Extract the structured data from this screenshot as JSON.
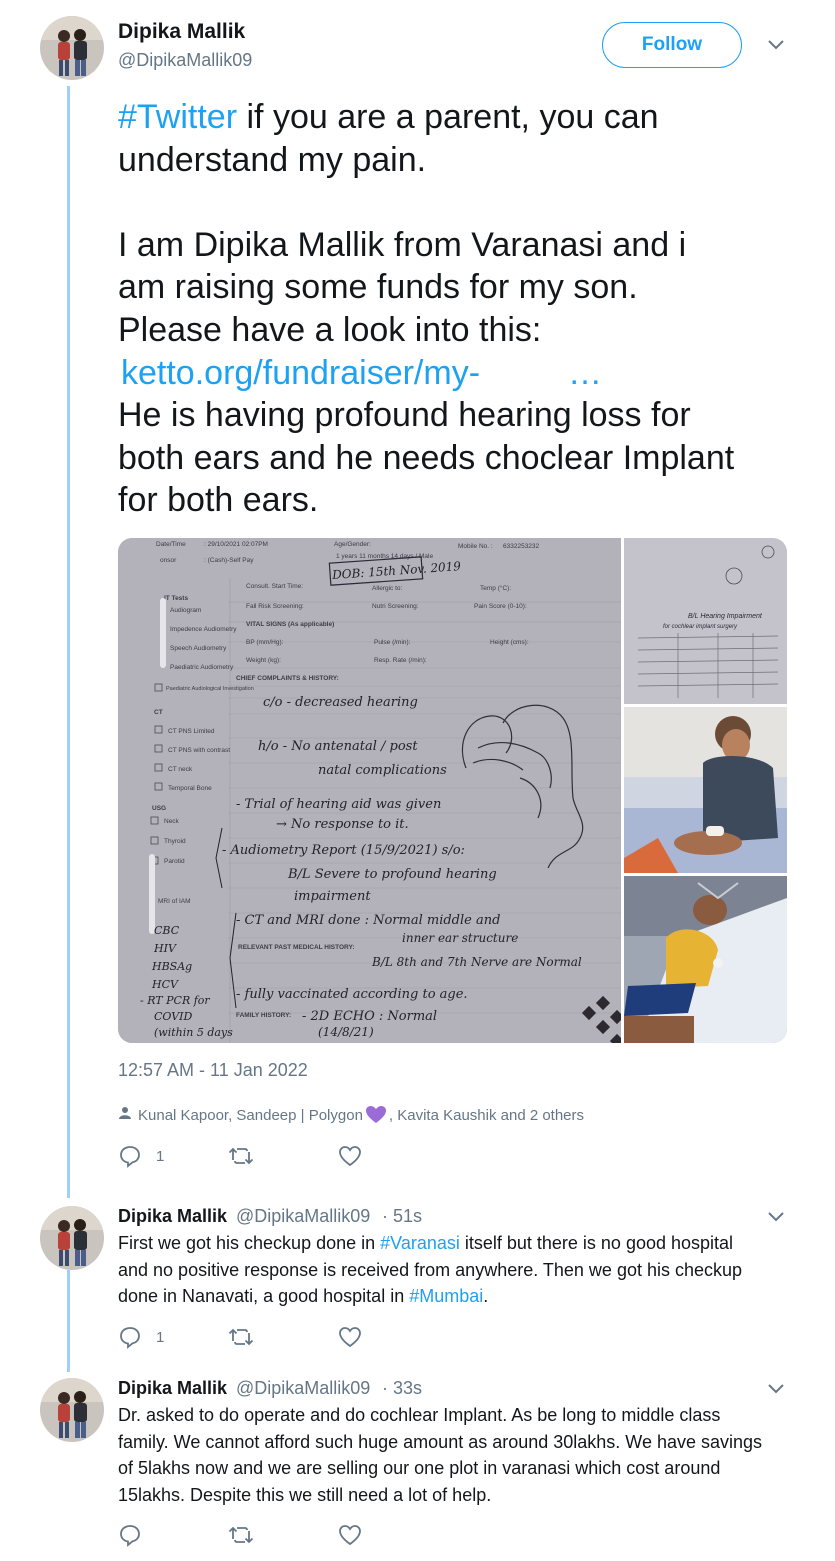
{
  "main_tweet": {
    "author_name": "Dipika Mallik",
    "author_handle": "@DipikaMallik09",
    "follow_label": "Follow",
    "text_lines": [
      {
        "hashtag": "#Twitter",
        "rest": " if you are a parent, you can"
      },
      {
        "text": "understand my pain."
      },
      {
        "text": ""
      },
      {
        "text": "I am Dipika Mallik from Varanasi and i"
      },
      {
        "text": "am raising some funds for my son."
      },
      {
        "text": "Please have a look into this:"
      },
      {
        "link": "ketto.org/fundraiser/my-",
        "ellipsis": "…"
      },
      {
        "text": "He is having profound hearing loss for"
      },
      {
        "text": "both ears and he needs choclear Implant"
      },
      {
        "text": "for both ears."
      }
    ],
    "timestamp": "12:57 AM - 11 Jan 2022",
    "liked_by": "Kunal Kapoor, Sandeep | Polygon",
    "liked_by_rest": ", Kavita Kaushik and 2 others",
    "reply_count": "1",
    "retweet_count": "",
    "like_count": "",
    "media": {
      "document_texts": {
        "date_label": "Date/Time",
        "date_value": ": 29/10/2021 02:07PM",
        "sponsor_label": "onsor",
        "sponsor_value": ": (Cash)-Self Pay",
        "age_label": "Age/Gender:",
        "age_value": "1 years 11 months 14 days / Male",
        "mobile_label": "Mobile No. :",
        "mobile_value": "6332253232",
        "dob": "DOB: 15th Nov. 2019",
        "consult": "Consult. Start Time:",
        "allergic": "Allergic to:",
        "temp": "Temp (°C):",
        "fall": "Fall Risk Screening:",
        "nutri": "Nutri Screening:",
        "pain": "Pain Score (0-10):",
        "tests": "IT Tests",
        "audiogram": "Audiogram",
        "impedance": "Impedence Audiometry",
        "speech": "Speech Audiometry",
        "paediatric": "Paediatric Audiometry",
        "paed_invest": "Paediatric Audiological Investigation",
        "vital": "VITAL SIGNS (As applicable)",
        "bp": "BP (mm/Hg):",
        "pulse": "Pulse (/min):",
        "height": "Height (cms):",
        "weight": "Weight (kg):",
        "resp": "Resp. Rate (/min):",
        "chief": "CHIEF COMPLAINTS & HISTORY:",
        "ct": "CT",
        "ct1": "CT PNS Limited",
        "ct2": "CT PNS with contrast",
        "ct3": "CT neck",
        "ct4": "Temporal Bone",
        "usg": "USG",
        "usg1": "Neck",
        "usg2": "Thyroid",
        "usg3": "Parotid",
        "mri": "MRI of IAM",
        "relevant": "RELEVANT PAST MEDICAL HISTORY:",
        "family": "FAMILY HISTORY:",
        "h1": "c/o - decreased hearing",
        "h2": "h/o - No antenatal / post",
        "h3": "natal complications",
        "h4": "- Trial of hearing aid was given",
        "h5": "→ No response to it.",
        "h6": "- Audiometry Report (15/9/2021) s/o:",
        "h7": "B/L Severe to profound hearing",
        "h8": "impairment",
        "h9": "- CT and MRI done : Normal middle and",
        "h10": "inner ear structure",
        "h11": "B/L 8th and 7th Nerve are Normal",
        "h12": "- fully vaccinated according to age.",
        "h13": "- 2D ECHO : Normal",
        "h14": "(14/8/21)",
        "margin_notes": [
          "CBC",
          "HIV",
          "HBSAg",
          "HCV",
          "- RT PCR for",
          "COVID",
          "(within 5 days"
        ],
        "side_heading": "B/L Hearing Impairment",
        "side_sub": "for cochlear implant surgery"
      }
    }
  },
  "replies": [
    {
      "author_name": "Dipika Mallik",
      "author_handle": "@DipikaMallik09",
      "time": "· 51s",
      "lines": [
        [
          {
            "t": "First we got his checkup done in "
          },
          {
            "t": "#Varanasi",
            "tag": true
          },
          {
            "t": " itself but there is no good hospital"
          }
        ],
        [
          {
            "t": "and no positive response is received from anywhere. Then we got his checkup"
          }
        ],
        [
          {
            "t": "done in Nanavati, a good hospital in "
          },
          {
            "t": "#Mumbai",
            "tag": true
          },
          {
            "t": "."
          }
        ]
      ],
      "reply_count": "1"
    },
    {
      "author_name": "Dipika Mallik",
      "author_handle": "@DipikaMallik09",
      "time": "· 33s",
      "lines": [
        [
          {
            "t": "Dr. asked to do operate and do cochlear Implant. As be long to middle class"
          }
        ],
        [
          {
            "t": "family. We cannot afford such huge amount as around 30lakhs. We have savings"
          }
        ],
        [
          {
            "t": "of 5lakhs now and we are selling our one plot in varanasi which cost around"
          }
        ],
        [
          {
            "t": "15lakhs. Despite this we still need a lot of help."
          }
        ]
      ],
      "reply_count": ""
    }
  ],
  "colors": {
    "accent": "#1da1f2",
    "muted": "#657786",
    "thread_line": "#9fd0f5",
    "heart_emoji": "#9b6bd6"
  },
  "icons": [
    "person-icon",
    "reply-icon",
    "retweet-icon",
    "like-icon",
    "chevron-down-icon",
    "purple-heart-icon"
  ]
}
